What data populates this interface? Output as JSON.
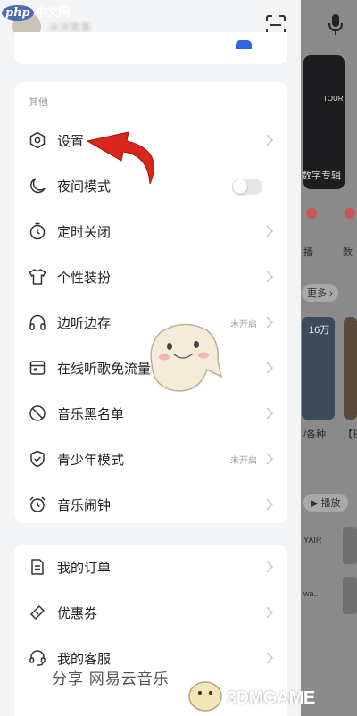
{
  "watermarks": {
    "top_left_php": "php",
    "top_left_cn": "中文网",
    "bottom_right": "3DMGAME"
  },
  "background_app": {
    "card_text": "数字专辑",
    "more_pill": "更多",
    "play_pill": "播放",
    "label_bo": "播",
    "label_shu": "数",
    "label_106": "16万",
    "label_gezhong": "/各种",
    "label_ri": "【日",
    "label_yair": "YAIR",
    "label_wa": "wa..",
    "label_tour": "TOUR"
  },
  "profile": {
    "username": "冰冰笑事"
  },
  "other_section": {
    "title": "其他",
    "items": [
      {
        "label": "设置",
        "icon": "hexagon-settings-icon"
      },
      {
        "label": "夜间模式",
        "icon": "moon-icon",
        "toggle": false
      },
      {
        "label": "定时关闭",
        "icon": "timer-icon"
      },
      {
        "label": "个性装扮",
        "icon": "tshirt-icon"
      },
      {
        "label": "边听边存",
        "icon": "headphones-icon",
        "status": "未开启"
      },
      {
        "label": "在线听歌免流量",
        "icon": "sim-card-icon"
      },
      {
        "label": "音乐黑名单",
        "icon": "ban-icon"
      },
      {
        "label": "青少年模式",
        "icon": "shield-icon",
        "status": "未开启"
      },
      {
        "label": "音乐闹钟",
        "icon": "alarm-icon"
      }
    ]
  },
  "orders_section": {
    "items": [
      {
        "label": "我的订单",
        "icon": "document-icon"
      },
      {
        "label": "优惠券",
        "icon": "ticket-icon"
      },
      {
        "label": "我的客服",
        "icon": "headset-icon"
      }
    ]
  },
  "bottom_banner": "分享      网易云音乐",
  "colors": {
    "accent": "#3063e8",
    "arrow": "#d9271c",
    "drawer_bg": "#f3f4f6"
  }
}
